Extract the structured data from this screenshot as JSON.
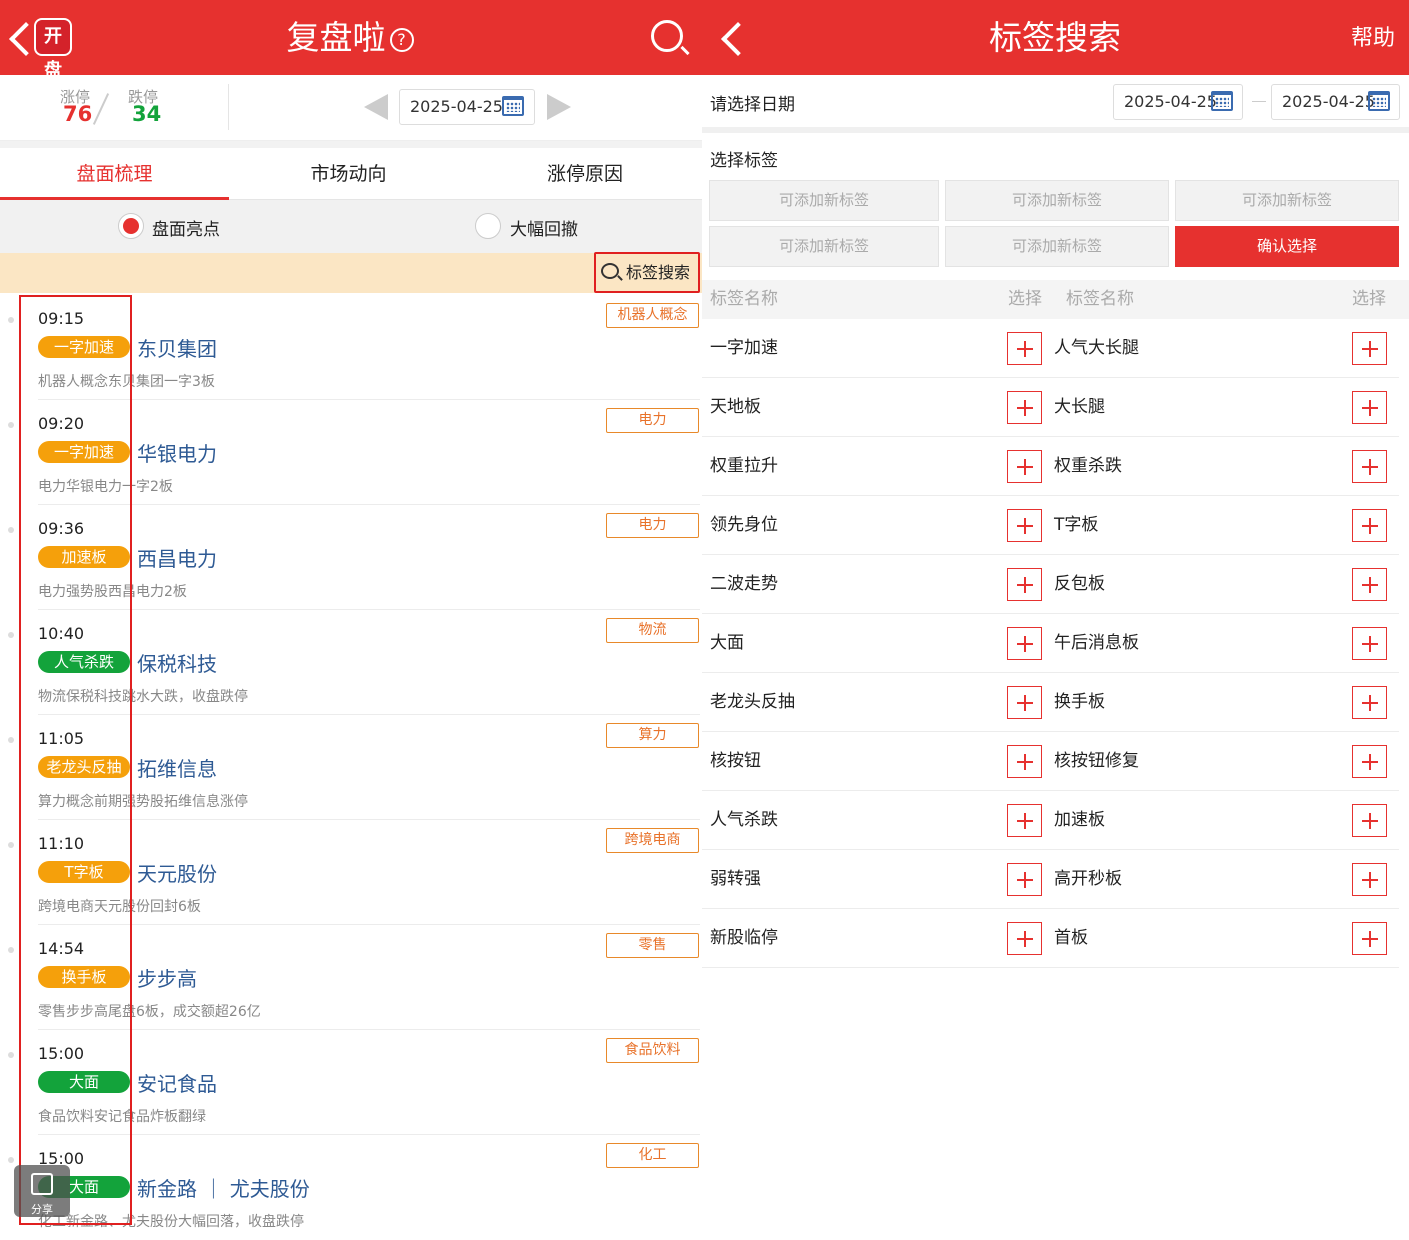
{
  "left": {
    "header": {
      "logo": "开盘",
      "title": "复盘啦",
      "help_icon": "?"
    },
    "stats": {
      "up_label": "涨停",
      "up_count": "76",
      "down_label": "跌停",
      "down_count": "34"
    },
    "date": "2025-04-25",
    "tabs": [
      "盘面梳理",
      "市场动向",
      "涨停原因"
    ],
    "radios": [
      "盘面亮点",
      "大幅回撤"
    ],
    "tag_search": "标签搜索",
    "events": [
      {
        "time": "09:15",
        "tag": "一字加速",
        "tag_color": "#f5a00b",
        "stock": "东贝集团",
        "desc": "机器人概念东贝集团一字3板",
        "category": "机器人概念"
      },
      {
        "time": "09:20",
        "tag": "一字加速",
        "tag_color": "#f5a00b",
        "stock": "华银电力",
        "desc": "电力华银电力一字2板",
        "category": "电力"
      },
      {
        "time": "09:36",
        "tag": "加速板",
        "tag_color": "#f5a00b",
        "stock": "西昌电力",
        "desc": "电力强势股西昌电力2板",
        "category": "电力"
      },
      {
        "time": "10:40",
        "tag": "人气杀跌",
        "tag_color": "#13a33b",
        "stock": "保税科技",
        "desc": "物流保税科技跳水大跌，收盘跌停",
        "category": "物流"
      },
      {
        "time": "11:05",
        "tag": "老龙头反抽",
        "tag_color": "#f5a00b",
        "stock": "拓维信息",
        "desc": "算力概念前期强势股拓维信息涨停",
        "category": "算力"
      },
      {
        "time": "11:10",
        "tag": "T字板",
        "tag_color": "#f5a00b",
        "stock": "天元股份",
        "desc": "跨境电商天元股份回封6板",
        "category": "跨境电商"
      },
      {
        "time": "14:54",
        "tag": "换手板",
        "tag_color": "#f5a00b",
        "stock": "步步高",
        "desc": "零售步步高尾盘6板，成交额超26亿",
        "category": "零售"
      },
      {
        "time": "15:00",
        "tag": "大面",
        "tag_color": "#13a33b",
        "stock": "安记食品",
        "desc": "食品饮料安记食品炸板翻绿",
        "category": "食品饮料"
      },
      {
        "time": "15:00",
        "tag": "大面",
        "tag_color": "#13a33b",
        "stock": "新金路 ｜ 尤夫股份",
        "desc": "化工新金路、尤夫股份大幅回落，收盘跌停",
        "category": "化工"
      }
    ],
    "share_label": "分享"
  },
  "right": {
    "header": {
      "title": "标签搜索",
      "help": "帮助"
    },
    "date_label": "请选择日期",
    "date_start": "2025-04-25",
    "date_end": "2025-04-25",
    "select_label": "选择标签",
    "chips": [
      "可添加新标签",
      "可添加新标签",
      "可添加新标签",
      "可添加新标签",
      "可添加新标签"
    ],
    "confirm": "确认选择",
    "columns": {
      "name": "标签名称",
      "select": "选择"
    },
    "rows": [
      [
        "一字加速",
        "人气大长腿"
      ],
      [
        "天地板",
        "大长腿"
      ],
      [
        "权重拉升",
        "权重杀跌"
      ],
      [
        "领先身位",
        "T字板"
      ],
      [
        "二波走势",
        "反包板"
      ],
      [
        "大面",
        "午后消息板"
      ],
      [
        "老龙头反抽",
        "换手板"
      ],
      [
        "核按钮",
        "核按钮修复"
      ],
      [
        "人气杀跌",
        "加速板"
      ],
      [
        "弱转强",
        "高开秒板"
      ],
      [
        "新股临停",
        "首板"
      ]
    ]
  },
  "colors": {
    "brand_red": "#e6312f",
    "up_red": "#e6312f",
    "down_green": "#13a33b",
    "tag_orange": "#f5a00b"
  }
}
